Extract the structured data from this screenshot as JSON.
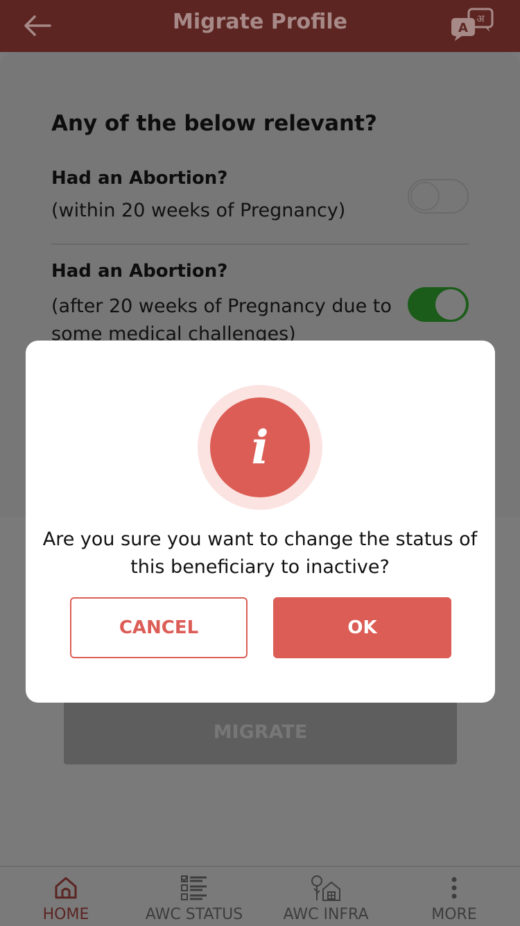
{
  "header": {
    "title": "Migrate Profile",
    "back_icon": "arrow-left-icon",
    "lang_icon": "translate-icon"
  },
  "form": {
    "heading": "Any of the below relevant?",
    "question1": {
      "title": "Had an Abortion?",
      "subtitle": "(within 20 weeks of Pregnancy)",
      "toggle": "off"
    },
    "question2": {
      "title": "Had an Abortion?",
      "subtitle": "(after 20 weeks of Pregnancy due to some medical challenges)",
      "toggle": "on"
    },
    "migrate_label": "MIGRATE"
  },
  "dialog": {
    "icon": "info-icon",
    "message": "Are you sure you want to change the status of this beneficiary to inactive?",
    "cancel_label": "CANCEL",
    "ok_label": "OK"
  },
  "bottom_nav": [
    {
      "label": "HOME",
      "icon": "home-icon"
    },
    {
      "label": "AWC STATUS",
      "icon": "checklist-icon"
    },
    {
      "label": "AWC INFRA",
      "icon": "building-icon"
    },
    {
      "label": "MORE",
      "icon": "more-vertical-icon"
    }
  ],
  "colors": {
    "accent": "#dc5d56",
    "header_dim": "#5c2522",
    "toggle_on_dim": "#1c5c1a"
  }
}
